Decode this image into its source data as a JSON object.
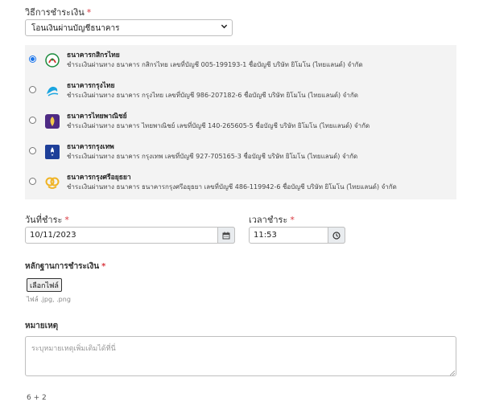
{
  "payment_method": {
    "label": "วิธีการชำระเงิน",
    "required_mark": "*",
    "selected": "โอนเงินผ่านบัญชีธนาคาร"
  },
  "banks": [
    {
      "name": "ธนาคารกสิกรไทย",
      "desc": "ชำระเงินผ่านทาง ธนาคาร กสิกรไทย เลขที่บัญชี 005-199193-1 ชื่อบัญชี บริษัท ยิโมโน (ไทยแลนด์) จำกัด",
      "checked": true,
      "color": "#1a8a3c",
      "icon": "kasikorn-logo-icon"
    },
    {
      "name": "ธนาคารกรุงไทย",
      "desc": "ชำระเงินผ่านทาง ธนาคาร กรุงไทย เลขที่บัญชี 986-207182-6 ชื่อบัญชี บริษัท ยิโมโน (ไทยแลนด์) จำกัด",
      "checked": false,
      "color": "#1ba5e0",
      "icon": "krungthai-logo-icon"
    },
    {
      "name": "ธนาคารไทยพาณิชย์",
      "desc": "ชำระเงินผ่านทาง ธนาคาร ไทยพาณิชย์ เลขที่บัญชี 140-265605-5 ชื่อบัญชี บริษัท ยิโมโน (ไทยแลนด์) จำกัด",
      "checked": false,
      "color": "#4e2a84",
      "icon": "scb-logo-icon"
    },
    {
      "name": "ธนาคารกรุงเทพ",
      "desc": "ชำระเงินผ่านทาง ธนาคาร กรุงเทพ เลขที่บัญชี 927-705165-3 ชื่อบัญชี บริษัท ยิโมโน (ไทยแลนด์) จำกัด",
      "checked": false,
      "color": "#1e3f99",
      "icon": "bangkok-bank-logo-icon"
    },
    {
      "name": "ธนาคารกรุงศรีอยุธยา",
      "desc": "ชำระเงินผ่านทาง ธนาคาร ธนาคารกรุงศรีอยุธยา เลขที่บัญชี 486-119942-6 ชื่อบัญชี บริษัท ยิโมโน (ไทยแลนด์) จำกัด",
      "checked": false,
      "color": "#f0b323",
      "icon": "krungsri-logo-icon"
    }
  ],
  "pay_date": {
    "label": "วันที่ชำระ",
    "required_mark": "*",
    "value": "10/11/2023",
    "icon": "calendar-icon"
  },
  "pay_time": {
    "label": "เวลาชำระ",
    "required_mark": "*",
    "value": "11:53",
    "icon": "clock-icon"
  },
  "proof": {
    "label": "หลักฐานการชำระเงิน",
    "required_mark": "*",
    "button": "เลือกไฟล์",
    "hint": "ไฟล์ .jpg, .png"
  },
  "note": {
    "label": "หมายเหตุ",
    "placeholder": "ระบุหมายเหตุเพิ่มเติมได้ที่นี่"
  },
  "footer": "6 + 2"
}
